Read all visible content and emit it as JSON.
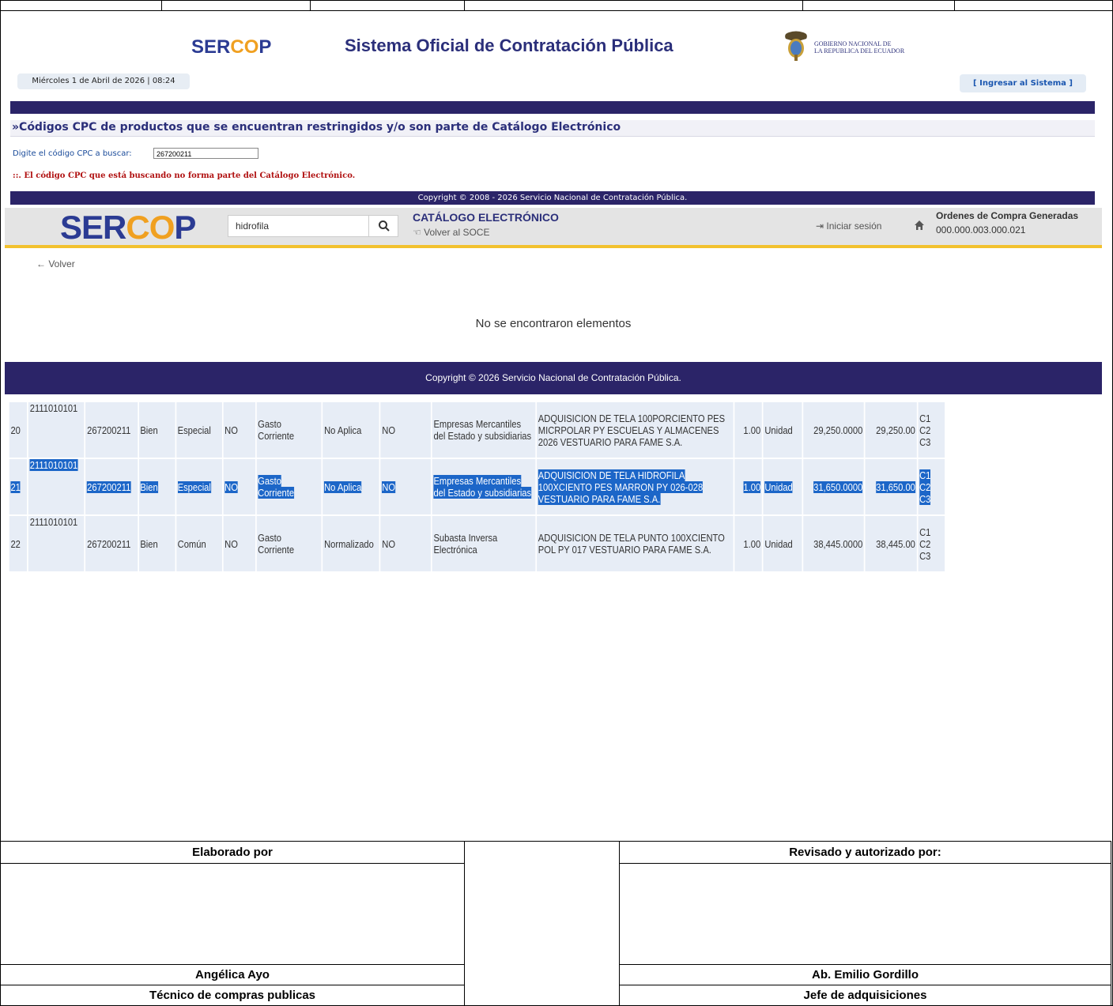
{
  "soce": {
    "logo": {
      "pre": "SER",
      "mid": "CO",
      "post": "P"
    },
    "title": "Sistema Oficial de Contratación Pública",
    "gov_line1": "GOBIERNO NACIONAL DE",
    "gov_line2": "LA REPUBLICA DEL ECUADOR",
    "date": "Miércoles 1 de Abril de 2026 | 08:24",
    "login": "[ Ingresar al Sistema ]",
    "cpc_heading": "»Códigos CPC de productos que se encuentran restringidos y/o son parte de Catálogo Electrónico",
    "search_label": "Digite el código CPC a buscar:",
    "search_value": "267200211",
    "message": "::. El código CPC que está buscando no forma parte del Catálogo Electrónico.",
    "copyright": "Copyright © 2008 - 2026 Servicio Nacional de Contratación Pública."
  },
  "catalogo": {
    "logo": {
      "pre": "SER",
      "mid": "CO",
      "post": "P"
    },
    "search_value": "hidrofila",
    "title": "CATÁLOGO ELECTRÓNICO",
    "back_soce": "Volver al SOCE",
    "login": "Iniciar sesión",
    "orders_title": "Ordenes de Compra Generadas",
    "orders_count": "000.000.003.000.021",
    "back": "Volver",
    "empty": "No se encontraron elementos",
    "copyright": "Copyright © 2026 Servicio Nacional de Contratación Pública."
  },
  "results": [
    {
      "n": "20",
      "id": "2111010101",
      "cpc": "267200211",
      "tipo": "Bien",
      "reg": "Especial",
      "f1": "NO",
      "gasto": "Gasto Corriente",
      "norm": "No Aplica",
      "f2": "NO",
      "proc": "Empresas Mercantiles del Estado y subsidiarias",
      "desc": "ADQUISICION DE TELA 100PORCIENTO PES MICRPOLAR PY ESCUELAS Y ALMACENES 2026 VESTUARIO PARA FAME S.A.",
      "cant": "1.00",
      "unidad": "Unidad",
      "pu": "29,250.0000",
      "total": "29,250.00",
      "c": "C1 C2 C3"
    },
    {
      "n": "21",
      "id": "2111010101",
      "cpc": "267200211",
      "tipo": "Bien",
      "reg": "Especial",
      "f1": "NO",
      "gasto": "Gasto Corriente",
      "norm": "No Aplica",
      "f2": "NO",
      "proc": "Empresas Mercantiles del Estado y subsidiarias",
      "desc": "ADQUISICION DE TELA HIDROFILA 100XCIENTO PES MARRON PY 026-028 VESTUARIO PARA FAME S.A.",
      "cant": "1.00",
      "unidad": "Unidad",
      "pu": "31,650.0000",
      "total": "31,650.00",
      "c": "C1 C2 C3"
    },
    {
      "n": "22",
      "id": "2111010101",
      "cpc": "267200211",
      "tipo": "Bien",
      "reg": "Común",
      "f1": "NO",
      "gasto": "Gasto Corriente",
      "norm": "Normalizado",
      "f2": "NO",
      "proc": "Subasta Inversa Electrónica",
      "desc": "ADQUISICION DE TELA PUNTO 100XCIENTO POL PY 017 VESTUARIO PARA FAME S.A.",
      "cant": "1.00",
      "unidad": "Unidad",
      "pu": "38,445.0000",
      "total": "38,445.00",
      "c": "C1 C2 C3"
    }
  ],
  "signatures": {
    "left_header": "Elaborado por",
    "right_header": "Revisado y autorizado por:",
    "left_name": "Angélica Ayo",
    "right_name": "Ab. Emilio Gordillo",
    "left_role": "Técnico de compras publicas",
    "right_role": "Jefe de adquisiciones"
  },
  "colors": {
    "navy": "#2b2468",
    "brand_blue": "#2b3b93",
    "brand_orange": "#f0a020",
    "highlight": "#1c66c8",
    "error": "#b01010"
  }
}
